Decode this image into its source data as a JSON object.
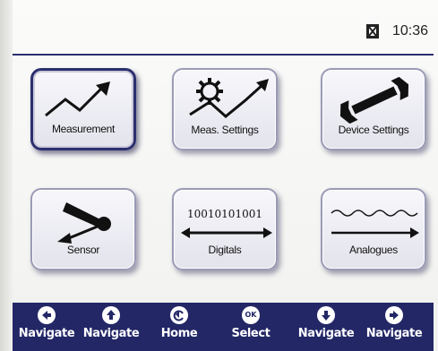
{
  "status": {
    "time": "10:36",
    "battery_icon": "battery-icon"
  },
  "tiles": [
    {
      "label": "Measurement",
      "icon": "trend-chart-icon"
    },
    {
      "label": "Meas. Settings",
      "icon": "gear-trend-icon"
    },
    {
      "label": "Device Settings",
      "icon": "wrench-icon"
    },
    {
      "label": "Sensor",
      "icon": "sensor-probe-icon"
    },
    {
      "label": "Digitals",
      "icon": "binary-arrows-icon",
      "digits_text": "10010101001"
    },
    {
      "label": "Analogues",
      "icon": "wave-arrows-icon"
    }
  ],
  "bottom_nav": [
    {
      "label": "Navigate",
      "icon": "arrow-left-icon"
    },
    {
      "label": "Navigate",
      "icon": "arrow-up-icon"
    },
    {
      "label": "Home",
      "icon": "home-return-icon"
    },
    {
      "label": "Select",
      "icon": "ok-icon",
      "icon_text": "OK"
    },
    {
      "label": "Navigate",
      "icon": "arrow-down-icon"
    },
    {
      "label": "Navigate",
      "icon": "arrow-right-icon"
    }
  ],
  "colors": {
    "bar": "#232766",
    "accent": "#2c2f6e",
    "tile_bg": "#ececf3"
  }
}
